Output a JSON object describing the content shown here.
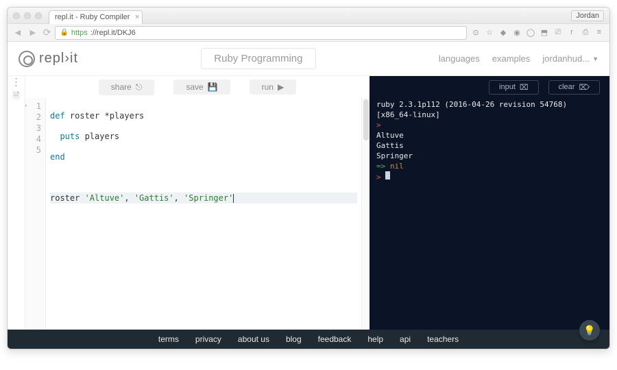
{
  "browser": {
    "tab_title": "repl.it - Ruby Compiler",
    "profile": "Jordan",
    "url_scheme": "https",
    "url_rest": "://repl.it/DKJ6"
  },
  "header": {
    "brand": "repl›it",
    "title": "Ruby Programming",
    "links": {
      "languages": "languages",
      "examples": "examples",
      "user": "jordanhud..."
    }
  },
  "editor_toolbar": {
    "share": "share",
    "save": "save",
    "run": "run"
  },
  "code": {
    "l1_kw": "def",
    "l1_rest": " roster *players",
    "l2_indent": "  ",
    "l2_kw": "puts",
    "l2_rest": " players",
    "l3": "end",
    "l5_call": "roster ",
    "l5_s1": "'Altuve'",
    "l5_c1": ", ",
    "l5_s2": "'Gattis'",
    "l5_c2": ", ",
    "l5_s3": "'Springer'"
  },
  "gutter": {
    "n1": "1",
    "n2": "2",
    "n3": "3",
    "n4": "4",
    "n5": "5"
  },
  "term_toolbar": {
    "input": "input",
    "clear": "clear"
  },
  "terminal": {
    "version": "ruby 2.3.1p112 (2016-04-26 revision 54768)",
    "platform": "[x86_64-linux]",
    "out1": "Altuve",
    "out2": "Gattis",
    "out3": "Springer",
    "arrow": "=>",
    "nil": "nil"
  },
  "footer": {
    "terms": "terms",
    "privacy": "privacy",
    "about": "about us",
    "blog": "blog",
    "feedback": "feedback",
    "help": "help",
    "api": "api",
    "teachers": "teachers"
  }
}
